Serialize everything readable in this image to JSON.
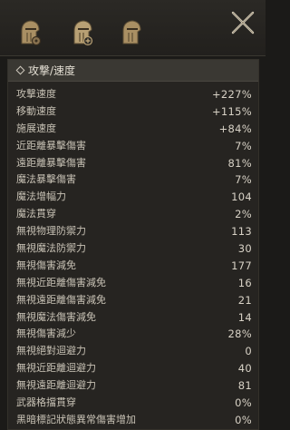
{
  "window": {
    "close_icon": "close-x-icon"
  },
  "tabs": [
    {
      "icon": "helmet-gear-icon"
    },
    {
      "icon": "helmet-plus-icon"
    },
    {
      "icon": "helmet-icon"
    }
  ],
  "section": {
    "title": "攻撃/速度"
  },
  "stats": [
    {
      "label": "攻撃速度",
      "value": "+227%"
    },
    {
      "label": "移動速度",
      "value": "+115%"
    },
    {
      "label": "施展速度",
      "value": "+84%"
    },
    {
      "label": "近距離暴擊傷害",
      "value": "7%"
    },
    {
      "label": "遠距離暴擊傷害",
      "value": "81%"
    },
    {
      "label": "魔法暴擊傷害",
      "value": "7%"
    },
    {
      "label": "魔法增幅力",
      "value": "104"
    },
    {
      "label": "魔法貫穿",
      "value": "2%"
    },
    {
      "label": "無視物理防禦力",
      "value": "113"
    },
    {
      "label": "無視魔法防禦力",
      "value": "30"
    },
    {
      "label": "無視傷害減免",
      "value": "177"
    },
    {
      "label": "無視近距離傷害減免",
      "value": "16"
    },
    {
      "label": "無視遠距離傷害減免",
      "value": "21"
    },
    {
      "label": "無視魔法傷害減免",
      "value": "14"
    },
    {
      "label": "無視傷害減少",
      "value": "28%"
    },
    {
      "label": "無視絕對迴避力",
      "value": "0"
    },
    {
      "label": "無視近距離迴避力",
      "value": "40"
    },
    {
      "label": "無視遠距離迴避力",
      "value": "81"
    },
    {
      "label": "武器格擋貫穿",
      "value": "0%"
    },
    {
      "label": "黑暗標記狀態異常傷害增加",
      "value": "0%"
    }
  ],
  "colors": {
    "background": "#1b1a18",
    "panel": "#262421",
    "header": "#3a3833",
    "text": "#cfc9bd",
    "icon_gold": "#b59a6a"
  }
}
